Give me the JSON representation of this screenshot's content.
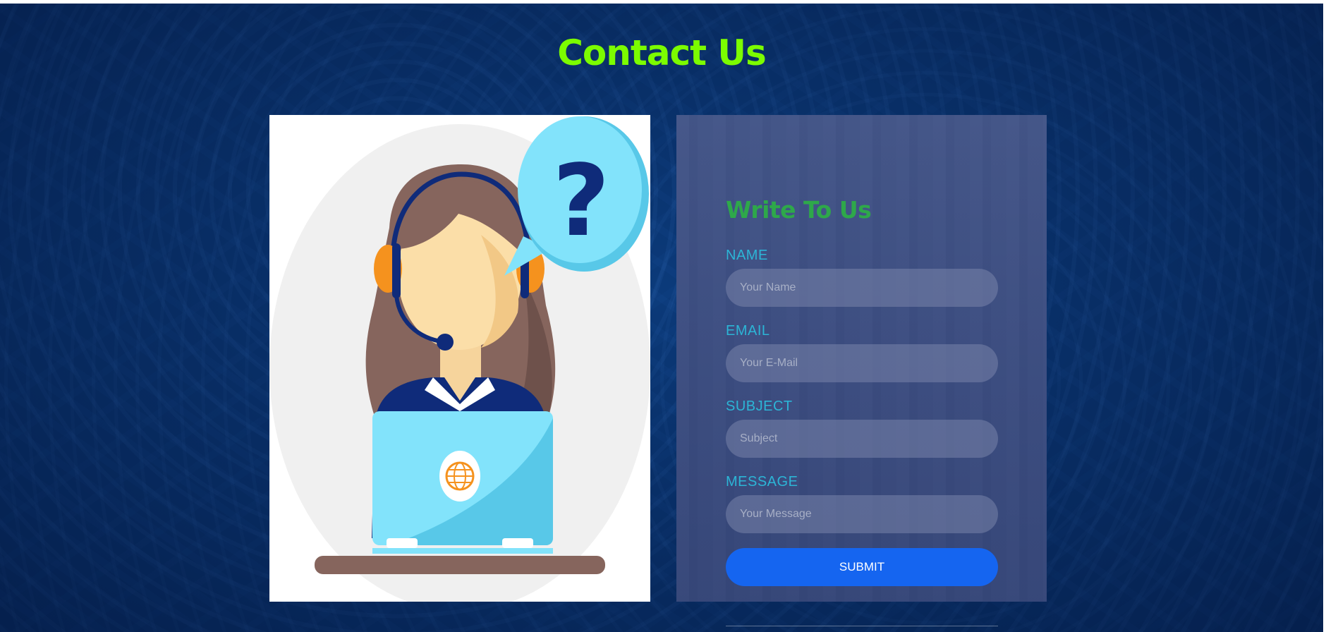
{
  "page": {
    "title": "Contact Us",
    "title_color": "#7cfc00",
    "background_color": "#0b3a7a"
  },
  "illustration": {
    "description_icon": "support-agent-illustration",
    "bubble_text": "?"
  },
  "form": {
    "title": "Write To Us",
    "title_color": "#2ea84a",
    "label_color": "#2cb5d6",
    "fields": {
      "name": {
        "label": "NAME",
        "placeholder": "Your Name"
      },
      "email": {
        "label": "EMAIL",
        "placeholder": "Your E-Mail"
      },
      "subject": {
        "label": "SUBJECT",
        "placeholder": "Subject"
      },
      "message": {
        "label": "MESSAGE",
        "placeholder": "Your Message"
      }
    },
    "submit": {
      "label": "SUBMIT",
      "color": "#1565f0"
    }
  }
}
